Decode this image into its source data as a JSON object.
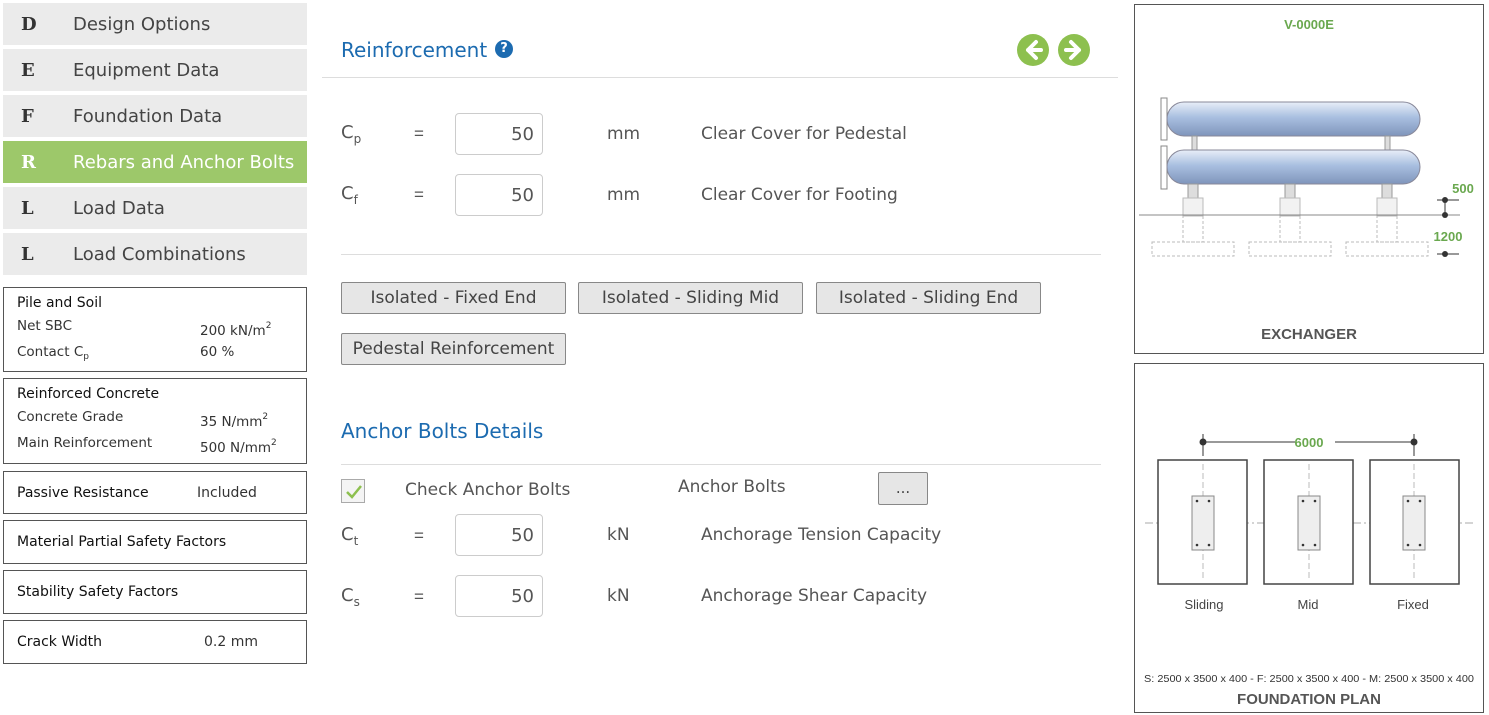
{
  "nav": [
    {
      "letter": "D",
      "label": "Design Options",
      "active": false
    },
    {
      "letter": "E",
      "label": "Equipment Data",
      "active": false
    },
    {
      "letter": "F",
      "label": "Foundation Data",
      "active": false
    },
    {
      "letter": "R",
      "label": "Rebars and Anchor Bolts",
      "active": true
    },
    {
      "letter": "L",
      "label": "Load Data",
      "active": false
    },
    {
      "letter": "L",
      "label": "Load Combinations",
      "active": false
    }
  ],
  "pile_soil": {
    "title": "Pile and Soil",
    "net_sbc_label": "Net SBC",
    "net_sbc_value": "200 kN/m",
    "net_sbc_sup": "2",
    "contact_label": "Contact C",
    "contact_sub": "p",
    "contact_value": "60 %"
  },
  "reinforced_concrete": {
    "title": "Reinforced Concrete",
    "grade_label": "Concrete Grade",
    "grade_value": "35 N/mm",
    "grade_sup": "2",
    "main_label": "Main Reinforcement",
    "main_value": "500 N/mm",
    "main_sup": "2"
  },
  "passive": {
    "title": "Passive Resistance",
    "value": "Included"
  },
  "material_psf": {
    "title": "Material Partial Safety Factors"
  },
  "stability_sf": {
    "title": "Stability Safety Factors"
  },
  "crack": {
    "title": "Crack Width",
    "value": "0.2 mm"
  },
  "reinforcement": {
    "heading": "Reinforcement",
    "help": "?",
    "rows": [
      {
        "sym": "C",
        "sub": "p",
        "eq": "=",
        "value": "50",
        "unit": "mm",
        "desc": "Clear Cover for Pedestal"
      },
      {
        "sym": "C",
        "sub": "f",
        "eq": "=",
        "value": "50",
        "unit": "mm",
        "desc": "Clear Cover for Footing"
      }
    ],
    "buttons": [
      "Isolated - Fixed End",
      "Isolated - Sliding Mid",
      "Isolated - Sliding End",
      "Pedestal Reinforcement"
    ]
  },
  "anchor": {
    "heading": "Anchor Bolts Details",
    "check_label": "Check Anchor Bolts",
    "checked": true,
    "bolts_label": "Anchor Bolts",
    "bolts_button": "...",
    "rows": [
      {
        "sym": "C",
        "sub": "t",
        "eq": "=",
        "value": "50",
        "unit": "kN",
        "desc": "Anchorage Tension Capacity"
      },
      {
        "sym": "C",
        "sub": "s",
        "eq": "=",
        "value": "50",
        "unit": "kN",
        "desc": "Anchorage Shear Capacity"
      }
    ]
  },
  "exchanger_drawing": {
    "tag": "V-0000E",
    "dim_top": "500",
    "dim_bottom": "1200",
    "caption": "EXCHANGER"
  },
  "plan_drawing": {
    "spacing": "6000",
    "labels": [
      "Sliding",
      "Mid",
      "Fixed"
    ],
    "sizes": "S: 2500 x 3500 x 400 - F: 2500 x 3500 x 400 - M: 2500 x 3500 x 400",
    "caption": "FOUNDATION PLAN"
  },
  "colors": {
    "accent_green": "#9dc86a",
    "arrow_green": "#8dc04f",
    "heading_blue": "#1c6bb0",
    "dim_green": "#6aa84f"
  }
}
